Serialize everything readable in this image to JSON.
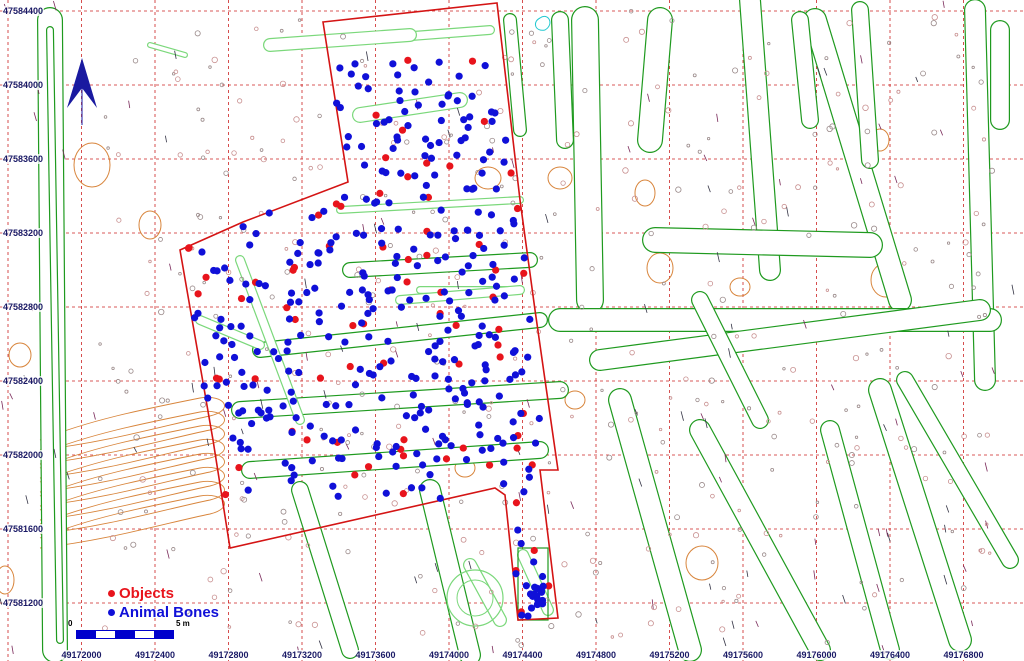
{
  "map": {
    "north_arrow_icon": "north-arrow-icon",
    "y_ticks": [
      "47584400",
      "47584000",
      "47583600",
      "47583200",
      "47582800",
      "47582400",
      "47582000",
      "47581600",
      "47581200"
    ],
    "x_ticks": [
      "49172000",
      "49172400",
      "49172800",
      "49173200",
      "49173600",
      "49174000",
      "49174400",
      "49174800",
      "49175200",
      "49175600",
      "49176000",
      "49176400",
      "49176800"
    ],
    "legend": [
      {
        "label": "Objects",
        "color": "#e8141c"
      },
      {
        "label": "Animal Bones",
        "color": "#1010d8"
      }
    ],
    "scale": {
      "start": "0",
      "end": "5 m"
    },
    "colors": {
      "grid": "#cc2222",
      "features": "#1f9a1f",
      "excavation_outline": "#d41414",
      "contours": "#d8853c",
      "small_finds": "#9a8a8a"
    }
  }
}
